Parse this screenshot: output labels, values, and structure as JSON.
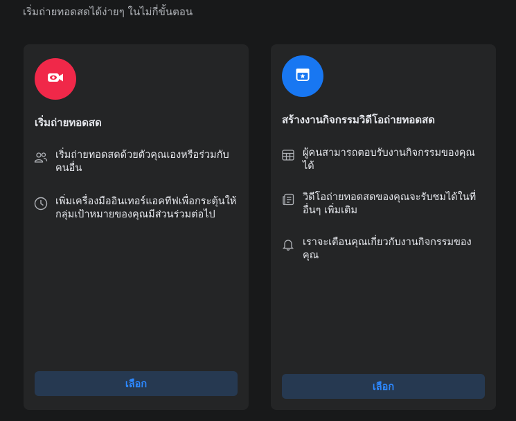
{
  "header": {
    "subtitle": "เริ่มถ่ายทอดสดได้ง่ายๆ ในไม่กี่ขั้นตอน"
  },
  "cards": [
    {
      "icon": "video-camera-icon",
      "accent": "#f02849",
      "title": "เริ่มถ่ายทอดสด",
      "features": [
        {
          "icon": "people-icon",
          "text": "เริ่มถ่ายทอดสดด้วยตัวคุณเองหรือร่วมกับคนอื่น"
        },
        {
          "icon": "clock-icon",
          "text": "เพิ่มเครื่องมืออินเทอร์แอคทีฟเพื่อกระตุ้นให้กลุ่มเป้าหมายของคุณมีส่วนร่วมต่อไป"
        }
      ],
      "button_label": "เลือก"
    },
    {
      "icon": "calendar-star-icon",
      "accent": "#1877f2",
      "title": "สร้างงานกิจกรรมวิดีโอถ่ายทอดสด",
      "features": [
        {
          "icon": "table-icon",
          "text": "ผู้คนสามารถตอบรับงานกิจกรรมของคุณได้"
        },
        {
          "icon": "news-feed-icon",
          "text": "วิดีโอถ่ายทอดสดของคุณจะรับชมได้ในที่อื่นๆ เพิ่มเติม"
        },
        {
          "icon": "bell-icon",
          "text": "เราจะเตือนคุณเกี่ยวกับงานกิจกรรมของคุณ"
        }
      ],
      "button_label": "เลือก"
    }
  ],
  "colors": {
    "background": "#18191a",
    "card": "#242526",
    "button_bg": "#263951",
    "button_text": "#2d88ff"
  }
}
